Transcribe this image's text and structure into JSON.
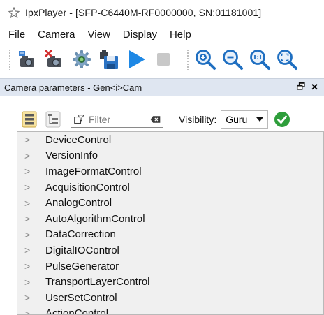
{
  "window": {
    "title": "IpxPlayer - [SFP-C6440M-RF0000000, SN:01181001]",
    "icon": "app-icon"
  },
  "menubar": {
    "items": [
      "File",
      "Camera",
      "View",
      "Display",
      "Help"
    ]
  },
  "toolbar": {
    "buttons": [
      {
        "icon": "camera-connect-icon"
      },
      {
        "icon": "camera-disconnect-icon"
      },
      {
        "icon": "camera-settings-gear-icon"
      },
      {
        "icon": "save-disk-icon"
      },
      {
        "icon": "play-icon"
      },
      {
        "icon": "stop-icon"
      },
      {
        "icon": "zoom-in-icon"
      },
      {
        "icon": "zoom-out-icon"
      },
      {
        "icon": "zoom-1to1-icon"
      },
      {
        "icon": "zoom-fit-icon"
      }
    ]
  },
  "panel": {
    "title": "Camera parameters - Gen<i>Cam",
    "float_icon": "float-window-icon",
    "close_label": "✕"
  },
  "param_toolbar": {
    "filter_placeholder": "Filter",
    "visibility_label": "Visibility:",
    "visibility_value": "Guru"
  },
  "tree": {
    "items": [
      "DeviceControl",
      "VersionInfo",
      "ImageFormatControl",
      "AcquisitionControl",
      "AnalogControl",
      "AutoAlgorithmControl",
      "DataCorrection",
      "DigitalIOControl",
      "PulseGenerator",
      "TransportLayerControl",
      "UserSetControl",
      "ActionControl"
    ]
  },
  "colors": {
    "panel_header_bg": "#dfe6f1",
    "tree_bg": "#f0f0f0",
    "play_blue": "#1e88e5",
    "zoom_blue": "#1f6fc1",
    "apply_green": "#2e9e3b"
  }
}
